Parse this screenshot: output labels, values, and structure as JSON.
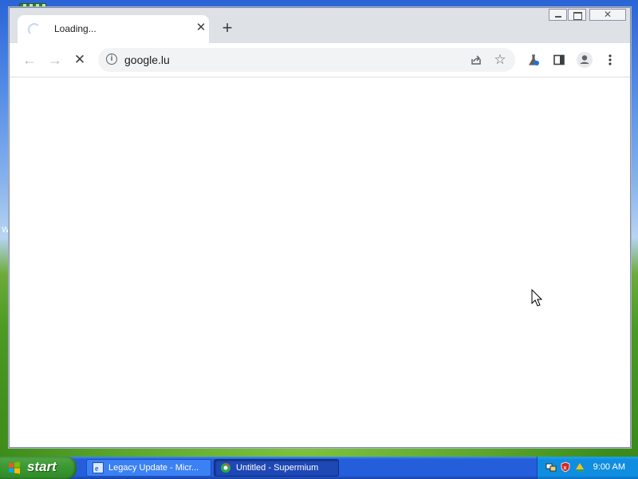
{
  "browser": {
    "tab": {
      "title": "Loading...",
      "close_glyph": "✕",
      "loading": true
    },
    "new_tab_glyph": "+",
    "window_controls": [
      "minimize",
      "maximize",
      "close"
    ],
    "toolbar": {
      "back_glyph": "←",
      "forward_glyph": "→",
      "stop_glyph": "✕",
      "back_enabled": false,
      "forward_enabled": false
    },
    "omnibox": {
      "url": "google.lu",
      "info_glyph": "i"
    },
    "actions": [
      "share-icon",
      "bookmark-star-icon",
      "labs-flask-icon",
      "side-panel-icon",
      "profile-icon",
      "menu-kebab-icon"
    ]
  },
  "desktop": {
    "peek_text": "W"
  },
  "taskbar": {
    "start_label": "start",
    "tasks": [
      {
        "label": "Legacy Update - Micr...",
        "active": false
      },
      {
        "label": "Untitled - Supermium",
        "active": true
      }
    ],
    "clock": "9:00 AM"
  },
  "colors": {
    "tabstrip": "#dee1e6",
    "omnibox": "#f1f3f4",
    "taskbar": "#245edb",
    "start": "#3c9a34",
    "tray": "#0f8de0"
  }
}
